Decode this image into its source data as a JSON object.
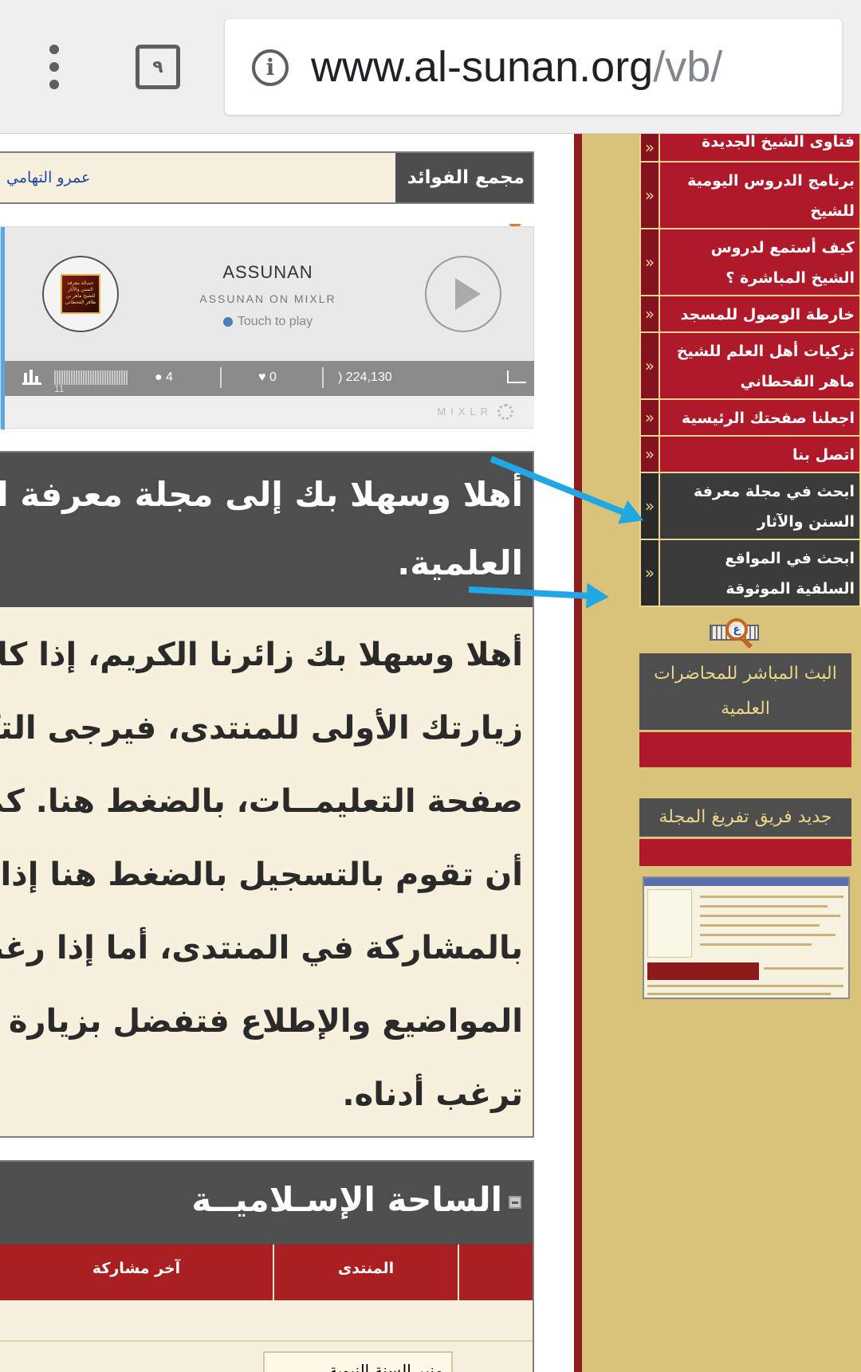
{
  "browser": {
    "url_domain": "www.al-sunan.org",
    "url_path": "/vb/",
    "tab_count": "٩",
    "icons": [
      "menu-dots-icon",
      "tabs-icon",
      "info-icon"
    ]
  },
  "breadcrumb": {
    "title": "مجمع الفوائد",
    "user": "عمرو التهامي"
  },
  "player": {
    "title": "ASSUNAN",
    "subtitle": "ASSUNAN ON MIXLR",
    "touch": "Touch to play",
    "level_value": "11",
    "listeners": "4",
    "hearts": "0",
    "plays": "224,130",
    "brand": "MIXLR",
    "art_text": "حصالة معرفة السنن والآثار للشيخ ماهر بن ظافر القحطاني"
  },
  "welcome": {
    "heading_lines": [
      "أهلا وسهلا بك إلى مجلة معرفة السنن والآثار",
      "العلمية."
    ],
    "body_lines": [
      "أهلا وسهلا بك زائرنا الكريم، إذا كانت هذه",
      "زيارتك الأولى للمنتدى، فيرجى التكرم بزيارة",
      "صفحة التعليمــات، بالضغط هنا. كما يشرفنا",
      "أن تقوم بالتسجيل بالضغط هنا إذا رغبت",
      "بالمشاركة في المنتدى، أما إذا رغبت بقراءة",
      "المواضيع والإطلاع فتفضل بزيارة القسم الذي",
      "ترغب أدناه."
    ]
  },
  "forum": {
    "title": "الساحة الإسـلاميــة",
    "col_forum": "المنتدى",
    "col_last": "آخر مشاركة",
    "row_snippet": "منبر السنة النبوية"
  },
  "sidebar": {
    "items": [
      {
        "label": "فتاوى الشيخ الجديدة",
        "dark": false
      },
      {
        "label": "برنامج الدروس اليومية للشيخ",
        "dark": false
      },
      {
        "label": "كيف أستمع لدروس الشيخ المباشرة ؟",
        "dark": false
      },
      {
        "label": "خارطة الوصول للمسجد",
        "dark": false
      },
      {
        "label": "تزكيات أهل العلم للشيخ ماهر القحطاني",
        "dark": false
      },
      {
        "label": "اجعلنا صفحتك الرئيسية",
        "dark": false
      },
      {
        "label": "اتصل بنا",
        "dark": false
      },
      {
        "label": "ابحث في مجلة معرفة السنن والآثار",
        "dark": true
      },
      {
        "label": "ابحث في المواقع السلفية الموثوقة",
        "dark": true
      }
    ],
    "chevron": "«",
    "search_icon_letter": "ع",
    "live_box_title": "البث المباشر للمحاضرات العلمية",
    "team_box_title": "جديد فريق تفريغ المجلة"
  },
  "colors": {
    "sidebar_bg": "#d9c27a",
    "menu_red": "#b0192a",
    "menu_dark": "#3b3b3b",
    "header_dark": "#4e4e4e",
    "content_bg": "#f6f0dd",
    "arrow_blue": "#1fa8e3"
  }
}
